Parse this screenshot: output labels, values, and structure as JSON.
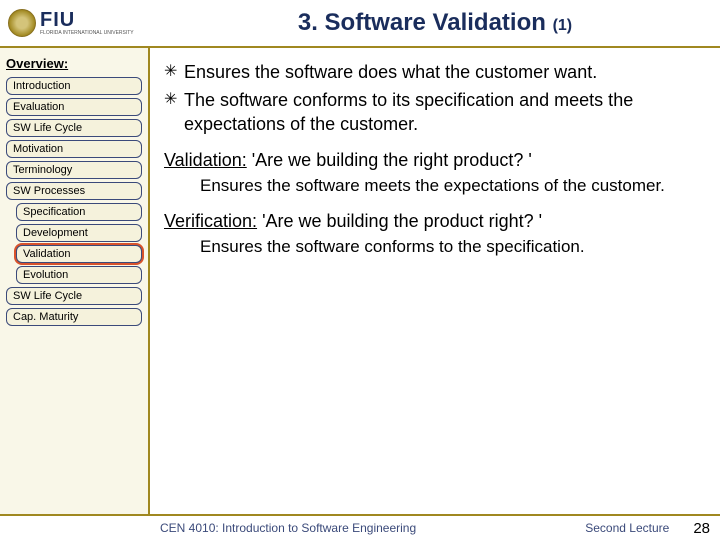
{
  "logo": {
    "fiu": "FIU",
    "sub": "FLORIDA INTERNATIONAL UNIVERSITY"
  },
  "title": {
    "main": "3. Software Validation",
    "sub": "(1)"
  },
  "sidebar": {
    "heading": "Overview:",
    "items": [
      {
        "label": "Introduction",
        "indent": false,
        "highlight": false
      },
      {
        "label": "Evaluation",
        "indent": false,
        "highlight": false
      },
      {
        "label": "SW Life Cycle",
        "indent": false,
        "highlight": false
      },
      {
        "label": "Motivation",
        "indent": false,
        "highlight": false
      },
      {
        "label": "Terminology",
        "indent": false,
        "highlight": false
      },
      {
        "label": "SW Processes",
        "indent": false,
        "highlight": false
      },
      {
        "label": "Specification",
        "indent": true,
        "highlight": false
      },
      {
        "label": "Development",
        "indent": true,
        "highlight": false
      },
      {
        "label": "Validation",
        "indent": true,
        "highlight": true
      },
      {
        "label": "Evolution",
        "indent": true,
        "highlight": false
      },
      {
        "label": "SW Life Cycle",
        "indent": false,
        "highlight": false
      },
      {
        "label": "Cap. Maturity",
        "indent": false,
        "highlight": false
      }
    ]
  },
  "bullets": [
    "Ensures the software does what the customer want.",
    "The software conforms to its specification and meets the expectations of the customer."
  ],
  "sections": [
    {
      "term": "Validation:",
      "quote": " 'Are we building the right product? '",
      "body": "Ensures the software meets the expectations of the customer."
    },
    {
      "term": "Verification:",
      "quote": " 'Are we building the product right? '",
      "body": "Ensures the software conforms to the specification."
    }
  ],
  "footer": {
    "left": "CEN 4010: Introduction to Software Engineering",
    "right": "Second Lecture",
    "page": "28"
  }
}
